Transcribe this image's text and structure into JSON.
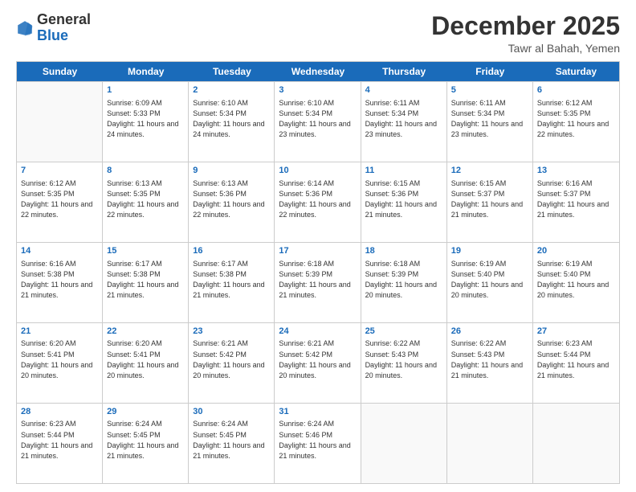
{
  "header": {
    "logo_general": "General",
    "logo_blue": "Blue",
    "month_title": "December 2025",
    "subtitle": "Tawr al Bahah, Yemen"
  },
  "calendar": {
    "days_of_week": [
      "Sunday",
      "Monday",
      "Tuesday",
      "Wednesday",
      "Thursday",
      "Friday",
      "Saturday"
    ],
    "rows": [
      [
        {
          "day": "",
          "empty": true
        },
        {
          "day": "1",
          "sunrise": "Sunrise: 6:09 AM",
          "sunset": "Sunset: 5:33 PM",
          "daylight": "Daylight: 11 hours and 24 minutes."
        },
        {
          "day": "2",
          "sunrise": "Sunrise: 6:10 AM",
          "sunset": "Sunset: 5:34 PM",
          "daylight": "Daylight: 11 hours and 24 minutes."
        },
        {
          "day": "3",
          "sunrise": "Sunrise: 6:10 AM",
          "sunset": "Sunset: 5:34 PM",
          "daylight": "Daylight: 11 hours and 23 minutes."
        },
        {
          "day": "4",
          "sunrise": "Sunrise: 6:11 AM",
          "sunset": "Sunset: 5:34 PM",
          "daylight": "Daylight: 11 hours and 23 minutes."
        },
        {
          "day": "5",
          "sunrise": "Sunrise: 6:11 AM",
          "sunset": "Sunset: 5:34 PM",
          "daylight": "Daylight: 11 hours and 23 minutes."
        },
        {
          "day": "6",
          "sunrise": "Sunrise: 6:12 AM",
          "sunset": "Sunset: 5:35 PM",
          "daylight": "Daylight: 11 hours and 22 minutes."
        }
      ],
      [
        {
          "day": "7",
          "sunrise": "Sunrise: 6:12 AM",
          "sunset": "Sunset: 5:35 PM",
          "daylight": "Daylight: 11 hours and 22 minutes."
        },
        {
          "day": "8",
          "sunrise": "Sunrise: 6:13 AM",
          "sunset": "Sunset: 5:35 PM",
          "daylight": "Daylight: 11 hours and 22 minutes."
        },
        {
          "day": "9",
          "sunrise": "Sunrise: 6:13 AM",
          "sunset": "Sunset: 5:36 PM",
          "daylight": "Daylight: 11 hours and 22 minutes."
        },
        {
          "day": "10",
          "sunrise": "Sunrise: 6:14 AM",
          "sunset": "Sunset: 5:36 PM",
          "daylight": "Daylight: 11 hours and 22 minutes."
        },
        {
          "day": "11",
          "sunrise": "Sunrise: 6:15 AM",
          "sunset": "Sunset: 5:36 PM",
          "daylight": "Daylight: 11 hours and 21 minutes."
        },
        {
          "day": "12",
          "sunrise": "Sunrise: 6:15 AM",
          "sunset": "Sunset: 5:37 PM",
          "daylight": "Daylight: 11 hours and 21 minutes."
        },
        {
          "day": "13",
          "sunrise": "Sunrise: 6:16 AM",
          "sunset": "Sunset: 5:37 PM",
          "daylight": "Daylight: 11 hours and 21 minutes."
        }
      ],
      [
        {
          "day": "14",
          "sunrise": "Sunrise: 6:16 AM",
          "sunset": "Sunset: 5:38 PM",
          "daylight": "Daylight: 11 hours and 21 minutes."
        },
        {
          "day": "15",
          "sunrise": "Sunrise: 6:17 AM",
          "sunset": "Sunset: 5:38 PM",
          "daylight": "Daylight: 11 hours and 21 minutes."
        },
        {
          "day": "16",
          "sunrise": "Sunrise: 6:17 AM",
          "sunset": "Sunset: 5:38 PM",
          "daylight": "Daylight: 11 hours and 21 minutes."
        },
        {
          "day": "17",
          "sunrise": "Sunrise: 6:18 AM",
          "sunset": "Sunset: 5:39 PM",
          "daylight": "Daylight: 11 hours and 21 minutes."
        },
        {
          "day": "18",
          "sunrise": "Sunrise: 6:18 AM",
          "sunset": "Sunset: 5:39 PM",
          "daylight": "Daylight: 11 hours and 20 minutes."
        },
        {
          "day": "19",
          "sunrise": "Sunrise: 6:19 AM",
          "sunset": "Sunset: 5:40 PM",
          "daylight": "Daylight: 11 hours and 20 minutes."
        },
        {
          "day": "20",
          "sunrise": "Sunrise: 6:19 AM",
          "sunset": "Sunset: 5:40 PM",
          "daylight": "Daylight: 11 hours and 20 minutes."
        }
      ],
      [
        {
          "day": "21",
          "sunrise": "Sunrise: 6:20 AM",
          "sunset": "Sunset: 5:41 PM",
          "daylight": "Daylight: 11 hours and 20 minutes."
        },
        {
          "day": "22",
          "sunrise": "Sunrise: 6:20 AM",
          "sunset": "Sunset: 5:41 PM",
          "daylight": "Daylight: 11 hours and 20 minutes."
        },
        {
          "day": "23",
          "sunrise": "Sunrise: 6:21 AM",
          "sunset": "Sunset: 5:42 PM",
          "daylight": "Daylight: 11 hours and 20 minutes."
        },
        {
          "day": "24",
          "sunrise": "Sunrise: 6:21 AM",
          "sunset": "Sunset: 5:42 PM",
          "daylight": "Daylight: 11 hours and 20 minutes."
        },
        {
          "day": "25",
          "sunrise": "Sunrise: 6:22 AM",
          "sunset": "Sunset: 5:43 PM",
          "daylight": "Daylight: 11 hours and 20 minutes."
        },
        {
          "day": "26",
          "sunrise": "Sunrise: 6:22 AM",
          "sunset": "Sunset: 5:43 PM",
          "daylight": "Daylight: 11 hours and 21 minutes."
        },
        {
          "day": "27",
          "sunrise": "Sunrise: 6:23 AM",
          "sunset": "Sunset: 5:44 PM",
          "daylight": "Daylight: 11 hours and 21 minutes."
        }
      ],
      [
        {
          "day": "28",
          "sunrise": "Sunrise: 6:23 AM",
          "sunset": "Sunset: 5:44 PM",
          "daylight": "Daylight: 11 hours and 21 minutes."
        },
        {
          "day": "29",
          "sunrise": "Sunrise: 6:24 AM",
          "sunset": "Sunset: 5:45 PM",
          "daylight": "Daylight: 11 hours and 21 minutes."
        },
        {
          "day": "30",
          "sunrise": "Sunrise: 6:24 AM",
          "sunset": "Sunset: 5:45 PM",
          "daylight": "Daylight: 11 hours and 21 minutes."
        },
        {
          "day": "31",
          "sunrise": "Sunrise: 6:24 AM",
          "sunset": "Sunset: 5:46 PM",
          "daylight": "Daylight: 11 hours and 21 minutes."
        },
        {
          "day": "",
          "empty": true
        },
        {
          "day": "",
          "empty": true
        },
        {
          "day": "",
          "empty": true
        }
      ]
    ]
  }
}
